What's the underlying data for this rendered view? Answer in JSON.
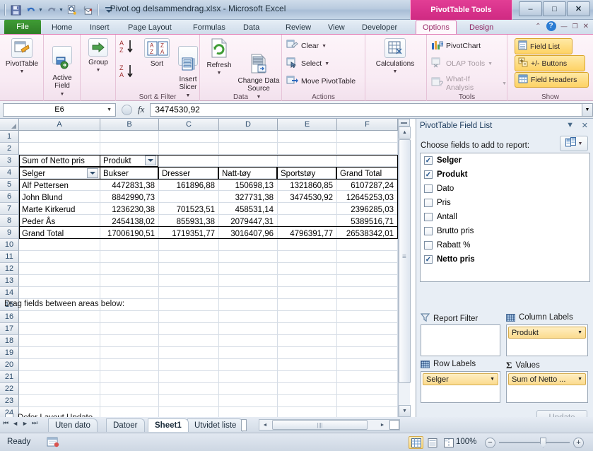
{
  "titlebar": {
    "document_title": "Pivot og delsammendrag.xlsx  -  Microsoft Excel",
    "context_tab_title": "PivotTable Tools",
    "qat": [
      {
        "name": "save-icon",
        "glyph": "💾"
      },
      {
        "name": "undo-icon",
        "glyph": "↶"
      },
      {
        "name": "redo-icon",
        "glyph": "↷"
      },
      {
        "name": "print-preview-icon",
        "glyph": "🔍"
      },
      {
        "name": "email-icon",
        "glyph": "✉"
      },
      {
        "name": "customize-qat-icon",
        "glyph": "▼"
      }
    ],
    "window_buttons": {
      "minimize": "–",
      "restore": "□",
      "close": "✕"
    }
  },
  "tabs": {
    "file": "File",
    "items": [
      "Home",
      "Insert",
      "Page Layout",
      "Formulas",
      "Data",
      "Review",
      "View",
      "Developer"
    ],
    "context_items": [
      "Options",
      "Design"
    ],
    "active": "Options",
    "help_icons": [
      {
        "name": "collapse-ribbon-icon",
        "glyph": "⌃"
      },
      {
        "name": "help-icon",
        "glyph": "?"
      },
      {
        "name": "window-minimize-icon",
        "glyph": "—"
      },
      {
        "name": "window-restore-icon",
        "glyph": "❐"
      },
      {
        "name": "window-close-icon",
        "glyph": "✕"
      }
    ]
  },
  "ribbon": {
    "groups": [
      {
        "label": "",
        "buttons": [
          {
            "label": "PivotTable",
            "has_caret": true
          }
        ]
      },
      {
        "label": "",
        "buttons": [
          {
            "label": "Active\nField",
            "has_caret": true
          }
        ]
      },
      {
        "label": "",
        "buttons": [
          {
            "label": "Group",
            "has_caret": true
          }
        ]
      },
      {
        "label": "Sort & Filter",
        "buttons": [
          {
            "label": "Sort"
          },
          {
            "label": "Insert\nSlicer",
            "has_caret": true
          }
        ]
      },
      {
        "label": "Data",
        "buttons": [
          {
            "label": "Refresh",
            "has_caret": true
          },
          {
            "label": "Change Data\nSource",
            "has_caret": true
          }
        ]
      },
      {
        "label": "Actions",
        "buttons": [
          {
            "label": "Clear"
          },
          {
            "label": "Select"
          },
          {
            "label": "Move PivotTable"
          }
        ]
      },
      {
        "label": "Tools",
        "buttons": [
          {
            "label": "Calculations",
            "has_caret": true
          },
          {
            "label": "PivotChart"
          },
          {
            "label": "OLAP Tools"
          },
          {
            "label": "What-If Analysis"
          }
        ]
      },
      {
        "label": "Show",
        "buttons": [
          {
            "label": "Field List"
          },
          {
            "label": "+/- Buttons"
          },
          {
            "label": "Field Headers"
          }
        ]
      }
    ],
    "labels": {
      "pivottable": "PivotTable",
      "active_field": "Active\nField",
      "group": "Group",
      "sort": "Sort",
      "insert_slicer": "Insert\nSlicer",
      "sort_filter_group": "Sort & Filter",
      "refresh": "Refresh",
      "change_data_source": "Change Data\nSource",
      "data_group": "Data",
      "clear": "Clear",
      "select": "Select",
      "move_pivottable": "Move PivotTable",
      "actions_group": "Actions",
      "calculations": "Calculations",
      "pivotchart": "PivotChart",
      "olap_tools": "OLAP Tools",
      "what_if": "What-If Analysis",
      "tools_group": "Tools",
      "field_list": "Field List",
      "plus_minus_buttons": "+/- Buttons",
      "field_headers": "Field Headers",
      "show_group": "Show",
      "sort_az": "A\nZ",
      "sort_za": "Z\nA"
    }
  },
  "formula_bar": {
    "name_box": "E6",
    "formula_value": "3474530,92",
    "fx_label": "fx"
  },
  "grid": {
    "columns": [
      "A",
      "B",
      "C",
      "D",
      "E",
      "F"
    ],
    "rows": [
      "1",
      "2",
      "3",
      "4",
      "5",
      "6",
      "7",
      "8",
      "9",
      "10",
      "11",
      "12",
      "13",
      "14",
      "15",
      "16",
      "17",
      "18",
      "19",
      "20",
      "21",
      "22",
      "23",
      "24"
    ],
    "pivot": {
      "value_header": "Sum of Netto pris",
      "column_field": "Produkt",
      "row_field": "Selger",
      "column_headers": [
        "Bukser",
        "Dresser",
        "Natt-tøy",
        "Sportstøy",
        "Grand Total"
      ],
      "rows": [
        {
          "label": "Alf Pettersen",
          "values": [
            "4472831,38",
            "161896,88",
            "150698,13",
            "1321860,85",
            "6107287,24"
          ]
        },
        {
          "label": "John Blund",
          "values": [
            "8842990,73",
            "",
            "327731,38",
            "3474530,92",
            "12645253,03"
          ]
        },
        {
          "label": "Marte Kirkerud",
          "values": [
            "1236230,38",
            "701523,51",
            "458531,14",
            "",
            "2396285,03"
          ]
        },
        {
          "label": "Peder Ås",
          "values": [
            "2454138,02",
            "855931,38",
            "2079447,31",
            "",
            "5389516,71"
          ]
        },
        {
          "label": "Grand Total",
          "values": [
            "17006190,51",
            "1719351,77",
            "3016407,96",
            "4796391,77",
            "26538342,01"
          ]
        }
      ]
    }
  },
  "field_list": {
    "title": "PivotTable Field List",
    "collapse_glyph": "▼",
    "close_glyph": "✕",
    "subtitle": "Choose fields to add to report:",
    "fields": [
      {
        "label": "Selger",
        "checked": true
      },
      {
        "label": "Produkt",
        "checked": true
      },
      {
        "label": "Dato",
        "checked": false
      },
      {
        "label": "Pris",
        "checked": false
      },
      {
        "label": "Antall",
        "checked": false
      },
      {
        "label": "Brutto pris",
        "checked": false
      },
      {
        "label": "Rabatt %",
        "checked": false
      },
      {
        "label": "Netto pris",
        "checked": true
      }
    ],
    "check_glyph": "✓",
    "drag_title": "Drag fields between areas below:",
    "areas": [
      {
        "name": "Report Filter",
        "icon": "filter-icon",
        "chips": []
      },
      {
        "name": "Column Labels",
        "icon": "grid-icon",
        "chips": [
          "Produkt"
        ]
      },
      {
        "name": "Row Labels",
        "icon": "grid-icon",
        "chips": [
          "Selger"
        ]
      },
      {
        "name": "Values",
        "icon": "sigma-icon",
        "chips": [
          "Sum of Netto ..."
        ]
      }
    ],
    "defer_label": "Defer Layout Update",
    "update_label": "Update"
  },
  "sheet_tabs": {
    "items": [
      "Uten dato",
      "Datoer",
      "Sheet1",
      "Utvidet liste"
    ],
    "active": "Sheet1",
    "nav": [
      "❘◀",
      "◀",
      "▶",
      "▶❘"
    ]
  },
  "status_bar": {
    "state": "Ready",
    "zoom": "100%",
    "view_modes": [
      "normal-view",
      "page-layout-view",
      "page-break-view"
    ],
    "zoom_out": "−",
    "zoom_in": "+"
  }
}
